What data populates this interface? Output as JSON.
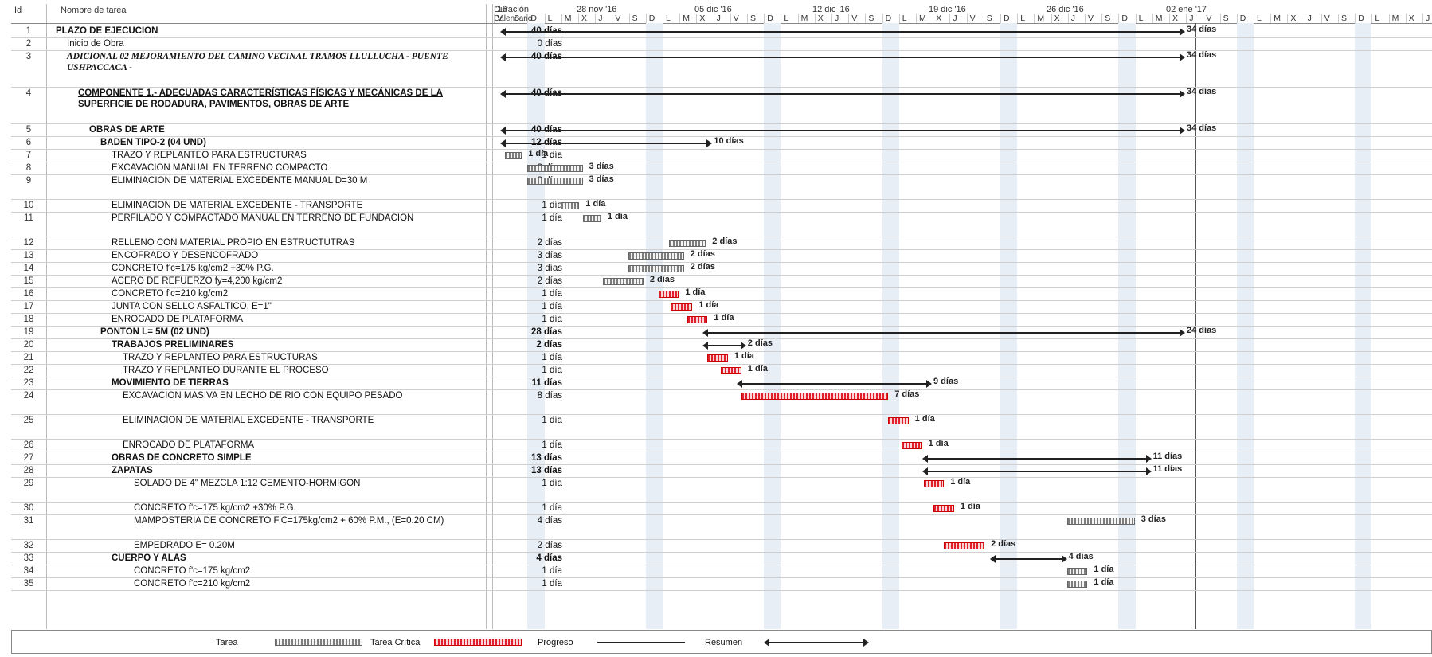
{
  "columns": {
    "id": "Id",
    "name": "Nombre de tarea",
    "duration_line1": "Duración",
    "duration_line2": "Calendario"
  },
  "timescale": {
    "weeks": [
      "'16",
      "28 nov '16",
      "05 dic '16",
      "12 dic '16",
      "19 dic '16",
      "26 dic '16",
      "02 ene '17"
    ],
    "days": [
      "V",
      "S",
      "D",
      "L",
      "M",
      "X",
      "J",
      "V",
      "S",
      "D",
      "L",
      "M",
      "X",
      "J",
      "V",
      "S",
      "D",
      "L",
      "M",
      "X",
      "J",
      "V",
      "S",
      "D",
      "L",
      "M",
      "X",
      "J",
      "V",
      "S",
      "D",
      "L",
      "M",
      "X",
      "J",
      "V",
      "S",
      "D",
      "L",
      "M",
      "X",
      "J",
      "V",
      "S",
      "D",
      "L",
      "M",
      "X",
      "J",
      "V",
      "S",
      "D",
      "L",
      "M",
      "X",
      "J",
      "V",
      "S",
      "D",
      "L",
      "M",
      "X",
      "J",
      "V",
      "S",
      "D",
      "L",
      "M",
      "X",
      "J",
      "V",
      "S"
    ]
  },
  "rows": [
    {
      "id": "1",
      "name": "PLAZO DE EJECUCION",
      "dur": "40 días",
      "style": "bold",
      "indent": 0,
      "lines": 1,
      "bar": {
        "type": "sum",
        "start": 0,
        "len": 40
      },
      "label": "34 días"
    },
    {
      "id": "2",
      "name": "Inicio de Obra",
      "dur": "0 días",
      "style": "",
      "indent": 1,
      "lines": 1,
      "bar": null,
      "label": ""
    },
    {
      "id": "3",
      "name": "ADICIONAL 02 MEJORAMIENTO DEL CAMINO VECINAL TRAMOS LLULLUCHA - PUENTE USHPACCACA -",
      "dur": "40 días",
      "style": "italic",
      "indent": 1,
      "lines": 3,
      "bar": {
        "type": "sum",
        "start": 0,
        "len": 40
      },
      "label": "34 días"
    },
    {
      "id": "4",
      "name": "COMPONENTE 1.- ADECUADAS CARACTERÍSTICAS FÍSICAS Y MECÁNICAS DE LA SUPERFICIE DE RODADURA, PAVIMENTOS, OBRAS DE ARTE",
      "dur": "40 días",
      "style": "bold underline",
      "indent": 2,
      "lines": 3,
      "bar": {
        "type": "sum",
        "start": 0,
        "len": 40
      },
      "label": "34 días"
    },
    {
      "id": "5",
      "name": "OBRAS DE ARTE",
      "dur": "40 días",
      "style": "bold",
      "indent": 3,
      "lines": 1,
      "bar": {
        "type": "sum",
        "start": 0,
        "len": 40
      },
      "label": "34 días"
    },
    {
      "id": "6",
      "name": "BADEN TIPO-2 (04 UND)",
      "dur": "12 días",
      "style": "bold",
      "indent": 4,
      "lines": 1,
      "bar": {
        "type": "sum",
        "start": 0,
        "len": 12
      },
      "label": "10 días"
    },
    {
      "id": "7",
      "name": "TRAZO Y REPLANTEO PARA ESTRUCTURAS",
      "dur": "1 día",
      "style": "",
      "indent": 5,
      "lines": 1,
      "bar": {
        "type": "task",
        "start": 0,
        "len": 1
      },
      "label": "1 día"
    },
    {
      "id": "8",
      "name": "EXCAVACION MANUAL EN TERRENO COMPACTO",
      "dur": "3 días",
      "style": "",
      "indent": 5,
      "lines": 1,
      "bar": {
        "type": "task",
        "start": 1.3,
        "len": 3.3
      },
      "label": "3 días"
    },
    {
      "id": "9",
      "name": "ELIMINACION DE MATERIAL EXCEDENTE MANUAL D=30 M",
      "dur": "3 días",
      "style": "",
      "indent": 5,
      "lines": 2,
      "bar": {
        "type": "task",
        "start": 1.3,
        "len": 3.3
      },
      "label": "3 días"
    },
    {
      "id": "10",
      "name": "ELIMINACION DE MATERIAL EXCEDENTE - TRANSPORTE",
      "dur": "1 día",
      "style": "",
      "indent": 5,
      "lines": 1,
      "bar": {
        "type": "task",
        "start": 3.3,
        "len": 1.1
      },
      "label": "1 día"
    },
    {
      "id": "11",
      "name": "PERFILADO Y COMPACTADO MANUAL EN TERRENO DE FUNDACION",
      "dur": "1 día",
      "style": "",
      "indent": 5,
      "lines": 2,
      "bar": {
        "type": "task",
        "start": 4.6,
        "len": 1.1
      },
      "label": "1 día"
    },
    {
      "id": "12",
      "name": "RELLENO CON MATERIAL PROPIO EN ESTRUCTUTRAS",
      "dur": "2 días",
      "style": "",
      "indent": 5,
      "lines": 1,
      "bar": {
        "type": "task",
        "start": 9.7,
        "len": 2.2
      },
      "label": "2 días"
    },
    {
      "id": "13",
      "name": "ENCOFRADO Y DESENCOFRADO",
      "dur": "3 días",
      "style": "",
      "indent": 5,
      "lines": 1,
      "bar": {
        "type": "task",
        "start": 7.3,
        "len": 3.3
      },
      "label": "2 días"
    },
    {
      "id": "14",
      "name": "CONCRETO f'c=175 kg/cm2 +30% P.G.",
      "dur": "3 días",
      "style": "",
      "indent": 5,
      "lines": 1,
      "bar": {
        "type": "task",
        "start": 7.3,
        "len": 3.3
      },
      "label": "2 días"
    },
    {
      "id": "15",
      "name": "ACERO DE REFUERZO fy=4,200 kg/cm2",
      "dur": "2 días",
      "style": "",
      "indent": 5,
      "lines": 1,
      "bar": {
        "type": "task",
        "start": 5.8,
        "len": 2.4
      },
      "label": "2 días"
    },
    {
      "id": "16",
      "name": "CONCRETO f'c=210 kg/cm2",
      "dur": "1 día",
      "style": "",
      "indent": 5,
      "lines": 1,
      "bar": {
        "type": "crit",
        "start": 9.1,
        "len": 1.2
      },
      "label": "1 día"
    },
    {
      "id": "17",
      "name": "JUNTA CON SELLO ASFALTICO, E=1\"",
      "dur": "1 día",
      "style": "",
      "indent": 5,
      "lines": 1,
      "bar": {
        "type": "crit",
        "start": 9.8,
        "len": 1.3
      },
      "label": "1 día"
    },
    {
      "id": "18",
      "name": "ENROCADO DE PLATAFORMA",
      "dur": "1 día",
      "style": "",
      "indent": 5,
      "lines": 1,
      "bar": {
        "type": "crit",
        "start": 10.8,
        "len": 1.2
      },
      "label": "1 día"
    },
    {
      "id": "19",
      "name": "PONTON L= 5M (02 UND)",
      "dur": "28 días",
      "style": "bold",
      "indent": 4,
      "lines": 1,
      "bar": {
        "type": "sum",
        "start": 12,
        "len": 28
      },
      "label": "24 días"
    },
    {
      "id": "20",
      "name": "TRABAJOS PRELIMINARES",
      "dur": "2 días",
      "style": "bold",
      "indent": 5,
      "lines": 1,
      "bar": {
        "type": "sum",
        "start": 12,
        "len": 2
      },
      "label": "2 días"
    },
    {
      "id": "21",
      "name": "TRAZO Y REPLANTEO PARA ESTRUCTURAS",
      "dur": "1 día",
      "style": "",
      "indent": 6,
      "lines": 1,
      "bar": {
        "type": "crit",
        "start": 12,
        "len": 1.2
      },
      "label": "1 día"
    },
    {
      "id": "22",
      "name": "TRAZO Y REPLANTEO DURANTE EL PROCESO",
      "dur": "1 día",
      "style": "",
      "indent": 6,
      "lines": 1,
      "bar": {
        "type": "crit",
        "start": 12.8,
        "len": 1.2
      },
      "label": "1 día"
    },
    {
      "id": "23",
      "name": "MOVIMIENTO DE TIERRAS",
      "dur": "11 días",
      "style": "bold",
      "indent": 5,
      "lines": 1,
      "bar": {
        "type": "sum",
        "start": 14,
        "len": 11
      },
      "label": "9 días"
    },
    {
      "id": "24",
      "name": "EXCAVACION MASIVA EN LECHO DE RIO CON EQUIPO PESADO",
      "dur": "8 días",
      "style": "",
      "indent": 6,
      "lines": 2,
      "bar": {
        "type": "crit",
        "start": 14,
        "len": 8.7
      },
      "label": "7 días"
    },
    {
      "id": "25",
      "name": "ELIMINACION DE MATERIAL EXCEDENTE - TRANSPORTE",
      "dur": "1 día",
      "style": "",
      "indent": 6,
      "lines": 2,
      "bar": {
        "type": "crit",
        "start": 22.7,
        "len": 1.2
      },
      "label": "1 día"
    },
    {
      "id": "26",
      "name": "ENROCADO DE PLATAFORMA",
      "dur": "1 día",
      "style": "",
      "indent": 6,
      "lines": 1,
      "bar": {
        "type": "crit",
        "start": 23.5,
        "len": 1.2
      },
      "label": "1 día"
    },
    {
      "id": "27",
      "name": "OBRAS DE CONCRETO SIMPLE",
      "dur": "13 días",
      "style": "bold",
      "indent": 5,
      "lines": 1,
      "bar": {
        "type": "sum",
        "start": 25,
        "len": 13
      },
      "label": "11 días"
    },
    {
      "id": "28",
      "name": "ZAPATAS",
      "dur": "13 días",
      "style": "bold",
      "indent": 5,
      "lines": 1,
      "bar": {
        "type": "sum",
        "start": 25,
        "len": 13
      },
      "label": "11 días"
    },
    {
      "id": "29",
      "name": "SOLADO DE 4\" MEZCLA 1:12 CEMENTO-HORMIGON",
      "dur": "1 día",
      "style": "",
      "indent": 7,
      "lines": 2,
      "bar": {
        "type": "crit",
        "start": 24.8,
        "len": 1.2
      },
      "label": "1 día"
    },
    {
      "id": "30",
      "name": "CONCRETO f'c=175 kg/cm2 +30% P.G.",
      "dur": "1 día",
      "style": "",
      "indent": 7,
      "lines": 1,
      "bar": {
        "type": "crit",
        "start": 25.4,
        "len": 1.2
      },
      "label": "1 día"
    },
    {
      "id": "31",
      "name": "MAMPOSTERIA DE CONCRETO F'C=175kg/cm2 + 60% P.M., (E=0.20 CM)",
      "dur": "4 días",
      "style": "",
      "indent": 7,
      "lines": 2,
      "bar": {
        "type": "task",
        "start": 33.3,
        "len": 4
      },
      "label": "3 días"
    },
    {
      "id": "32",
      "name": "EMPEDRADO E= 0.20M",
      "dur": "2 días",
      "style": "",
      "indent": 7,
      "lines": 1,
      "bar": {
        "type": "crit",
        "start": 26,
        "len": 2.4
      },
      "label": "2 días"
    },
    {
      "id": "33",
      "name": "CUERPO Y ALAS",
      "dur": "4 días",
      "style": "bold",
      "indent": 5,
      "lines": 1,
      "bar": {
        "type": "sum",
        "start": 29,
        "len": 4
      },
      "label": "4 días"
    },
    {
      "id": "34",
      "name": "CONCRETO f'c=175 kg/cm2",
      "dur": "1 día",
      "style": "",
      "indent": 7,
      "lines": 1,
      "bar": {
        "type": "task",
        "start": 33.3,
        "len": 1.2
      },
      "label": "1 día"
    },
    {
      "id": "35",
      "name": "CONCRETO f'c=210 kg/cm2",
      "dur": "1 día",
      "style": "",
      "indent": 7,
      "lines": 1,
      "bar": {
        "type": "task",
        "start": 33.3,
        "len": 1.2
      },
      "label": "1 día"
    }
  ],
  "legend": {
    "task": "Tarea",
    "critical": "Tarea Crítica",
    "progress": "Progreso",
    "summary": "Resumen"
  },
  "colors": {
    "task_bar": "#7d7d7d",
    "critical_bar": "#e0202a",
    "weekend_shade": "#e7eef6"
  }
}
